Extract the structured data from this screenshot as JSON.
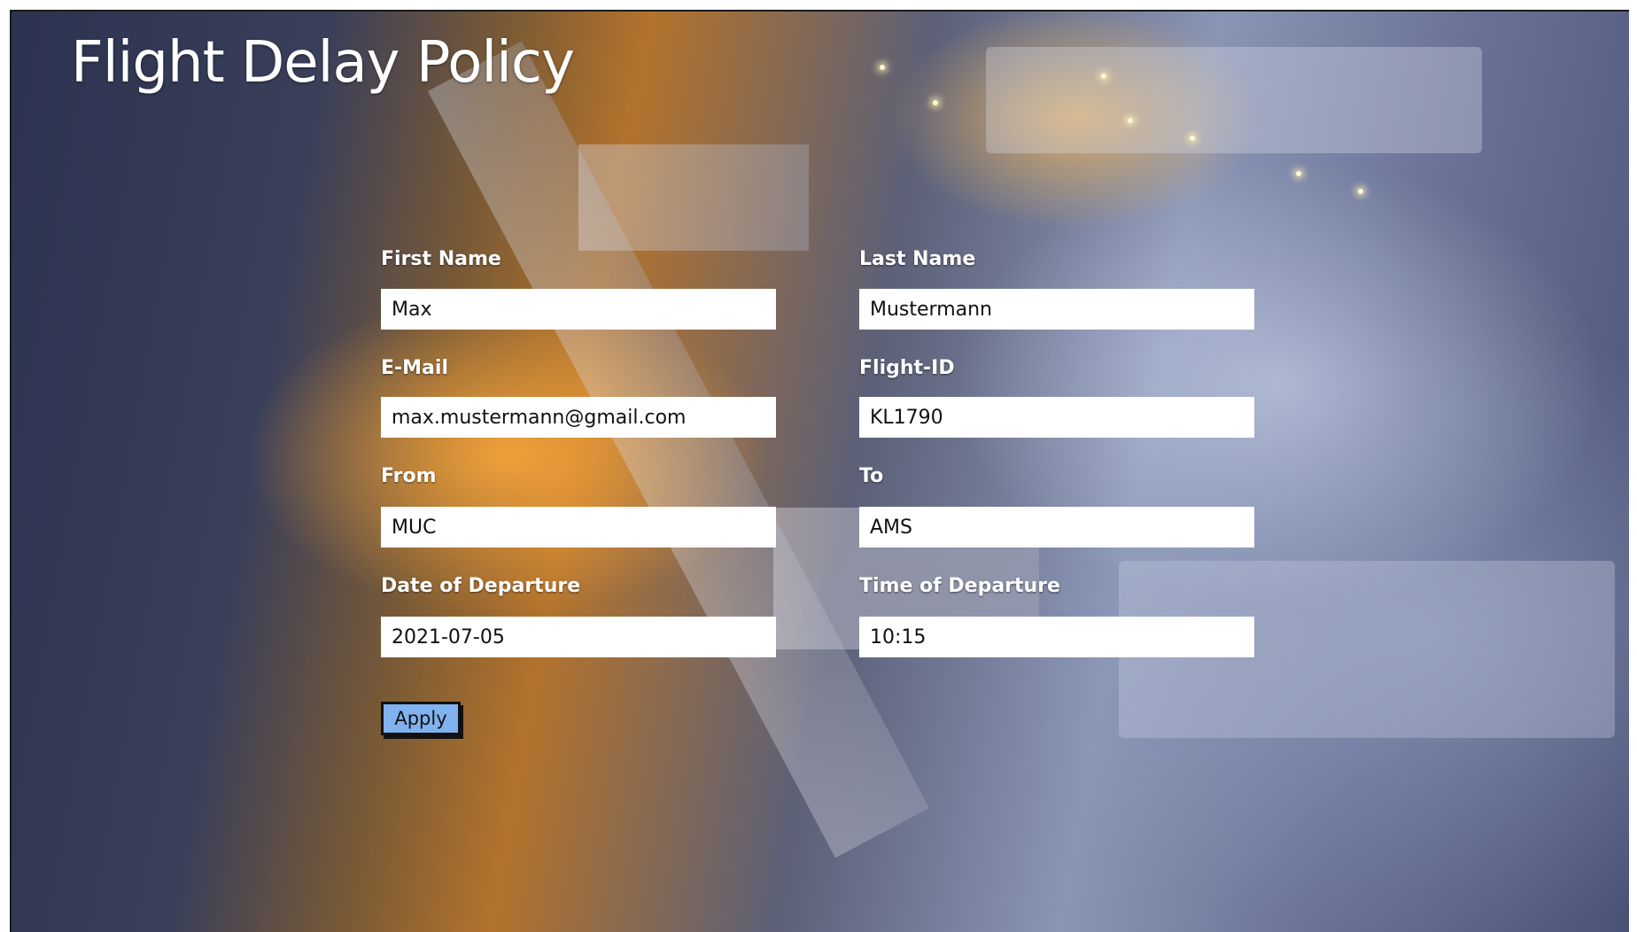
{
  "page": {
    "title": "Flight Delay Policy"
  },
  "form": {
    "first_name": {
      "label": "First Name",
      "value": "Max"
    },
    "last_name": {
      "label": "Last Name",
      "value": "Mustermann"
    },
    "email": {
      "label": "E-Mail",
      "value": "max.mustermann@gmail.com"
    },
    "flight_id": {
      "label": "Flight-ID",
      "value": "KL1790"
    },
    "from": {
      "label": "From",
      "value": "MUC"
    },
    "to": {
      "label": "To",
      "value": "AMS"
    },
    "date_of_departure": {
      "label": "Date of Departure",
      "value": "2021-07-05"
    },
    "time_of_departure": {
      "label": "Time of Departure",
      "value": "10:15"
    },
    "apply_label": "Apply"
  },
  "colors": {
    "button_bg": "#7fb2ee",
    "label_text": "#ffffff"
  }
}
